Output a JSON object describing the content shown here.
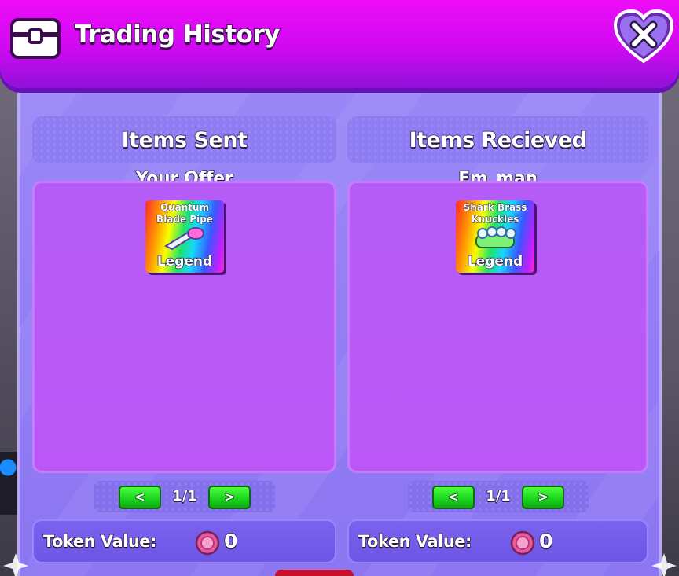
{
  "window": {
    "title": "Trading History",
    "close_symbol": "X"
  },
  "sent": {
    "header": "Items Sent",
    "owner_label": "Your Offer",
    "items": [
      {
        "name": "Quantum Blade Pipe",
        "rarity": "Legend",
        "icon": "blade-pipe-icon"
      }
    ],
    "pager": {
      "prev": "<",
      "page": "1/1",
      "next": ">"
    },
    "token_label": "Token Value:",
    "token_value": "0"
  },
  "received": {
    "header": "Items Recieved",
    "owner_label": "Em_man",
    "items": [
      {
        "name": "Shark Brass Knuckles",
        "rarity": "Legend",
        "icon": "brass-knuckles-icon"
      }
    ],
    "pager": {
      "prev": "<",
      "page": "1/1",
      "next": ">"
    },
    "token_label": "Token Value:",
    "token_value": "0"
  },
  "colors": {
    "header_magenta": "#e00cf5",
    "panel_purple": "#9a88f7",
    "items_box": "#b85af5",
    "pager_green": "#18d31c",
    "token_pink": "#e85a9e"
  }
}
